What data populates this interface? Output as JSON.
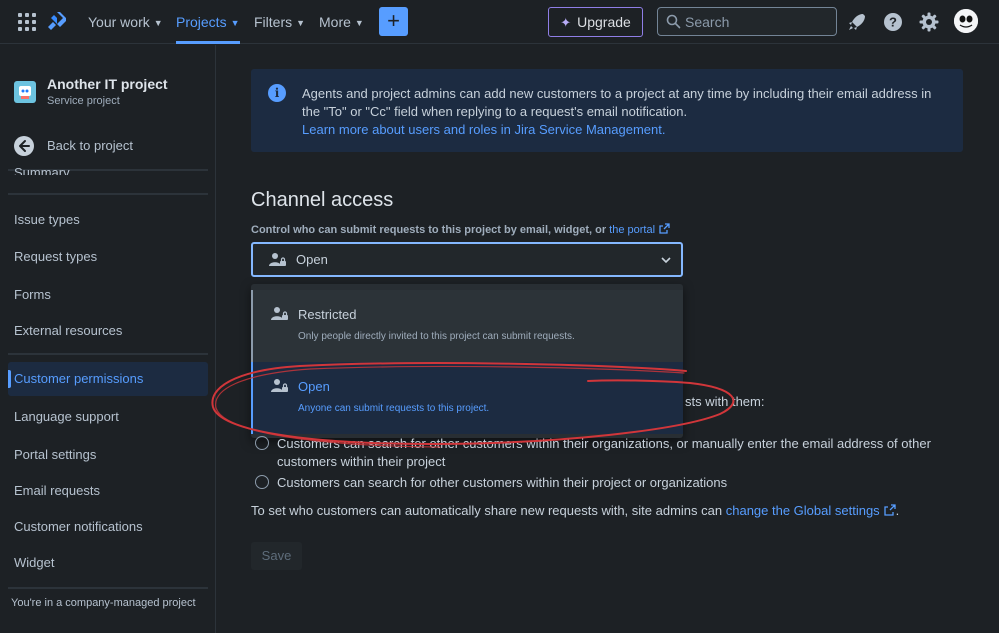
{
  "topnav": {
    "items": [
      {
        "label": "Your work"
      },
      {
        "label": "Projects"
      },
      {
        "label": "Filters"
      },
      {
        "label": "More"
      }
    ],
    "create_label": "+",
    "upgrade_label": "Upgrade",
    "search_placeholder": "Search",
    "accent_color": "#579dff"
  },
  "sidebar": {
    "project_name": "Another IT project",
    "project_type": "Service project",
    "back_label": "Back to project",
    "summary_label": "Summary",
    "items": [
      {
        "label": "Issue types"
      },
      {
        "label": "Request types"
      },
      {
        "label": "Forms"
      },
      {
        "label": "External resources"
      },
      {
        "label": "Customer permissions"
      },
      {
        "label": "Language support"
      },
      {
        "label": "Portal settings"
      },
      {
        "label": "Email requests"
      },
      {
        "label": "Customer notifications"
      },
      {
        "label": "Widget"
      }
    ],
    "footer": "You're in a company-managed project"
  },
  "info": {
    "text": "Agents and project admins can add new customers to a project at any time by including their email address in the \"To\" or \"Cc\" field when replying to a request's email notification.",
    "link": "Learn more about users and roles in Jira Service Management."
  },
  "channel": {
    "title": "Channel access",
    "label": "Control who can submit requests to this project by email, widget, or",
    "portal_link": "the portal",
    "selected": "Open",
    "options": [
      {
        "title": "Restricted",
        "desc": "Only people directly invited to this project can submit requests."
      },
      {
        "title": "Open",
        "desc": "Anyone can submit requests to this project."
      }
    ]
  },
  "sharing": {
    "partial": "sts with them:",
    "option1": "Customers can search for other customers within their organizations, or manually enter the email address of other customers within their project",
    "option2": "Customers can search for other customers within their project or organizations",
    "global_text": "To set who customers can automatically share new requests with, site admins can",
    "global_link": "change the Global settings",
    "global_end": "."
  },
  "save_label": "Save"
}
